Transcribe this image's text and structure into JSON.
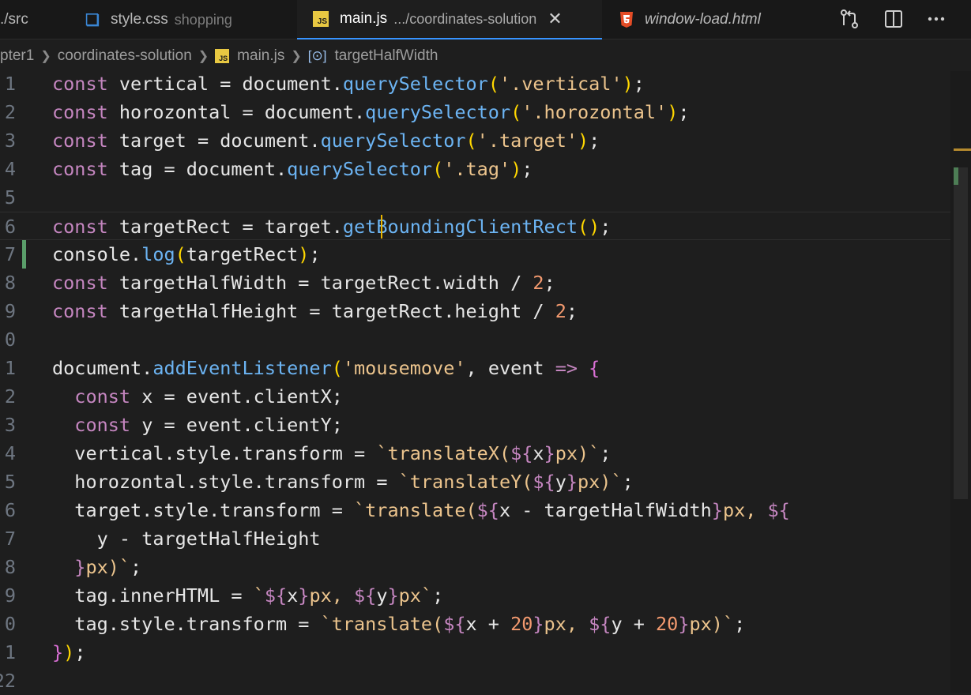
{
  "tabs": [
    {
      "name": "./src",
      "desc": ""
    },
    {
      "name": "style.css",
      "desc": "shopping"
    },
    {
      "name": "main.js",
      "desc": ".../coordinates-solution",
      "active": true
    },
    {
      "name": "window-load.html",
      "desc": "",
      "italic": true
    }
  ],
  "file_icons": {
    "css": "css-file-icon",
    "js": "js-file-icon",
    "html": "html5-file-icon"
  },
  "js_icon_text": "JS",
  "toolbar_icons": [
    "source-control-compare-icon",
    "split-editor-icon",
    "more-actions-icon"
  ],
  "breadcrumb": [
    "pter1",
    "coordinates-solution",
    "main.js",
    "targetHalfWidth"
  ],
  "gutter": [
    "1",
    "2",
    "3",
    "4",
    "5",
    "6",
    "7",
    "8",
    "9",
    "0",
    "1",
    "2",
    "3",
    "4",
    "5",
    "6",
    "7",
    "8",
    "9",
    "0",
    "1",
    "22"
  ],
  "colors": {
    "keyword": "#c586c0",
    "function": "#6cb4f3",
    "string": "#ecc48d",
    "number": "#f39a6f",
    "modified_gutter": "#5a9e6a",
    "cursor": "#e8b400"
  },
  "code_lines": [
    [
      [
        "k",
        "const"
      ],
      [
        "v",
        " vertical "
      ],
      [
        "o",
        "= "
      ],
      [
        "v",
        "document."
      ],
      [
        "f",
        "querySelector"
      ],
      [
        "p1",
        "("
      ],
      [
        "s",
        "'.vertical'"
      ],
      [
        "p1",
        ")"
      ],
      [
        "o",
        ";"
      ]
    ],
    [
      [
        "k",
        "const"
      ],
      [
        "v",
        " horozontal "
      ],
      [
        "o",
        "= "
      ],
      [
        "v",
        "document."
      ],
      [
        "f",
        "querySelector"
      ],
      [
        "p1",
        "("
      ],
      [
        "s",
        "'.horozontal'"
      ],
      [
        "p1",
        ")"
      ],
      [
        "o",
        ";"
      ]
    ],
    [
      [
        "k",
        "const"
      ],
      [
        "v",
        " target "
      ],
      [
        "o",
        "= "
      ],
      [
        "v",
        "document."
      ],
      [
        "f",
        "querySelector"
      ],
      [
        "p1",
        "("
      ],
      [
        "s",
        "'.target'"
      ],
      [
        "p1",
        ")"
      ],
      [
        "o",
        ";"
      ]
    ],
    [
      [
        "k",
        "const"
      ],
      [
        "v",
        " tag "
      ],
      [
        "o",
        "= "
      ],
      [
        "v",
        "document."
      ],
      [
        "f",
        "querySelector"
      ],
      [
        "p1",
        "("
      ],
      [
        "s",
        "'.tag'"
      ],
      [
        "p1",
        ")"
      ],
      [
        "o",
        ";"
      ]
    ],
    [],
    [
      [
        "k",
        "const"
      ],
      [
        "v",
        " targetRect "
      ],
      [
        "o",
        "= "
      ],
      [
        "v",
        "target."
      ],
      [
        "f",
        "getBoundingClientRect"
      ],
      [
        "p1",
        "()"
      ],
      [
        "o",
        ";"
      ]
    ],
    [
      [
        "v",
        "console."
      ],
      [
        "f",
        "log"
      ],
      [
        "p1",
        "("
      ],
      [
        "v",
        "targetRect"
      ],
      [
        "p1",
        ")"
      ],
      [
        "o",
        ";"
      ]
    ],
    [
      [
        "k",
        "const"
      ],
      [
        "v",
        " targetHalfWidth "
      ],
      [
        "o",
        "= "
      ],
      [
        "v",
        "targetRect.width "
      ],
      [
        "o",
        "/ "
      ],
      [
        "n",
        "2"
      ],
      [
        "o",
        ";"
      ]
    ],
    [
      [
        "k",
        "const"
      ],
      [
        "v",
        " targetHalfHeight "
      ],
      [
        "o",
        "= "
      ],
      [
        "v",
        "targetRect.height "
      ],
      [
        "o",
        "/ "
      ],
      [
        "n",
        "2"
      ],
      [
        "o",
        ";"
      ]
    ],
    [],
    [
      [
        "v",
        "document."
      ],
      [
        "f",
        "addEventListener"
      ],
      [
        "p1",
        "("
      ],
      [
        "s",
        "'mousemove'"
      ],
      [
        "o",
        ", "
      ],
      [
        "v",
        "event "
      ],
      [
        "k",
        "=>"
      ],
      [
        "o",
        " "
      ],
      [
        "p2",
        "{"
      ]
    ],
    [
      [
        "o",
        "  "
      ],
      [
        "k",
        "const"
      ],
      [
        "v",
        " x "
      ],
      [
        "o",
        "= "
      ],
      [
        "v",
        "event.clientX"
      ],
      [
        "o",
        ";"
      ]
    ],
    [
      [
        "o",
        "  "
      ],
      [
        "k",
        "const"
      ],
      [
        "v",
        " y "
      ],
      [
        "o",
        "= "
      ],
      [
        "v",
        "event.clientY"
      ],
      [
        "o",
        ";"
      ]
    ],
    [
      [
        "o",
        "  "
      ],
      [
        "v",
        "vertical.style.transform "
      ],
      [
        "o",
        "= "
      ],
      [
        "s",
        "`translateX("
      ],
      [
        "k",
        "${"
      ],
      [
        "v",
        "x"
      ],
      [
        "k",
        "}"
      ],
      [
        "s",
        "px)`"
      ],
      [
        "o",
        ";"
      ]
    ],
    [
      [
        "o",
        "  "
      ],
      [
        "v",
        "horozontal.style.transform "
      ],
      [
        "o",
        "= "
      ],
      [
        "s",
        "`translateY("
      ],
      [
        "k",
        "${"
      ],
      [
        "v",
        "y"
      ],
      [
        "k",
        "}"
      ],
      [
        "s",
        "px)`"
      ],
      [
        "o",
        ";"
      ]
    ],
    [
      [
        "o",
        "  "
      ],
      [
        "v",
        "target.style.transform "
      ],
      [
        "o",
        "= "
      ],
      [
        "s",
        "`translate("
      ],
      [
        "k",
        "${"
      ],
      [
        "v",
        "x "
      ],
      [
        "o",
        "- "
      ],
      [
        "v",
        "targetHalfWidth"
      ],
      [
        "k",
        "}"
      ],
      [
        "s",
        "px, "
      ],
      [
        "k",
        "${"
      ]
    ],
    [
      [
        "o",
        "    "
      ],
      [
        "v",
        "y "
      ],
      [
        "o",
        "- "
      ],
      [
        "v",
        "targetHalfHeight"
      ]
    ],
    [
      [
        "o",
        "  "
      ],
      [
        "k",
        "}"
      ],
      [
        "s",
        "px)`"
      ],
      [
        "o",
        ";"
      ]
    ],
    [
      [
        "o",
        "  "
      ],
      [
        "v",
        "tag.innerHTML "
      ],
      [
        "o",
        "= "
      ],
      [
        "s",
        "`"
      ],
      [
        "k",
        "${"
      ],
      [
        "v",
        "x"
      ],
      [
        "k",
        "}"
      ],
      [
        "s",
        "px, "
      ],
      [
        "k",
        "${"
      ],
      [
        "v",
        "y"
      ],
      [
        "k",
        "}"
      ],
      [
        "s",
        "px`"
      ],
      [
        "o",
        ";"
      ]
    ],
    [
      [
        "o",
        "  "
      ],
      [
        "v",
        "tag.style.transform "
      ],
      [
        "o",
        "= "
      ],
      [
        "s",
        "`translate("
      ],
      [
        "k",
        "${"
      ],
      [
        "v",
        "x "
      ],
      [
        "o",
        "+ "
      ],
      [
        "n",
        "20"
      ],
      [
        "k",
        "}"
      ],
      [
        "s",
        "px, "
      ],
      [
        "k",
        "${"
      ],
      [
        "v",
        "y "
      ],
      [
        "o",
        "+ "
      ],
      [
        "n",
        "20"
      ],
      [
        "k",
        "}"
      ],
      [
        "s",
        "px)`"
      ],
      [
        "o",
        ";"
      ]
    ],
    [
      [
        "p2",
        "}"
      ],
      [
        "p1",
        ")"
      ],
      [
        "o",
        ";"
      ]
    ],
    []
  ]
}
